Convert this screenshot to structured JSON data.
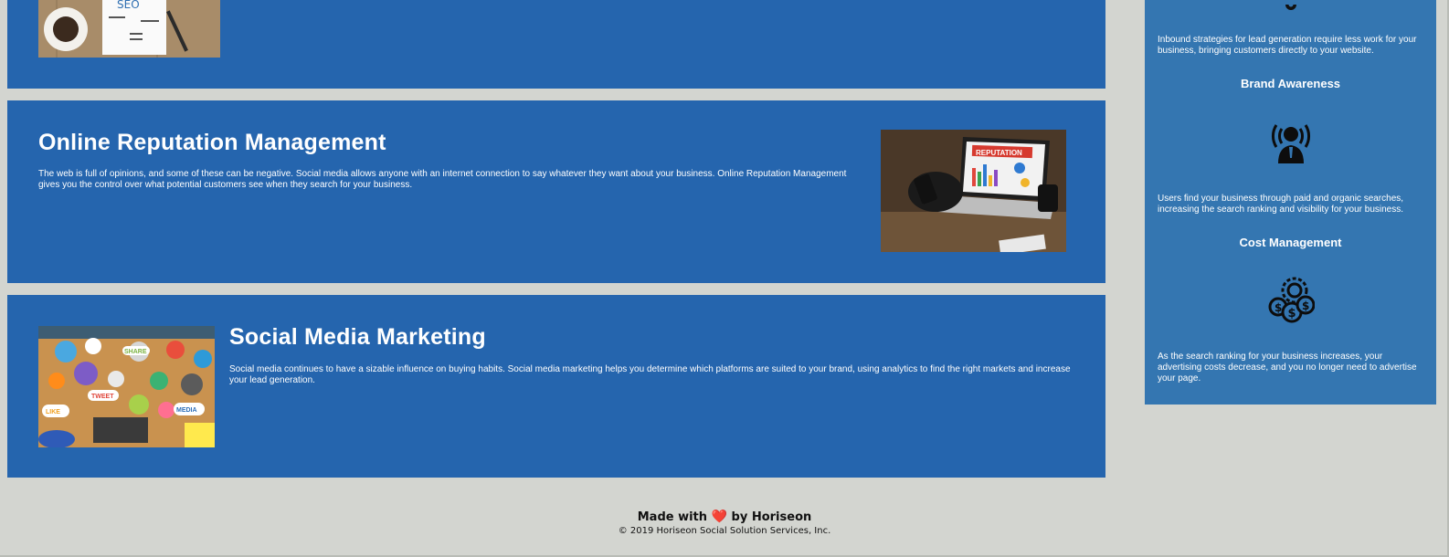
{
  "articles": {
    "seo": {
      "image_alt": "SEO"
    },
    "online_reputation": {
      "title": "Online Reputation Management",
      "text": "The web is full of opinions, and some of these can be negative. Social media allows anyone with an internet connection to say whatever they want about your business. Online Reputation Management gives you the control over what potential customers see when they search for your business.",
      "image_label": "REPUTATION"
    },
    "social_media": {
      "title": "Social Media Marketing",
      "text": "Social media continues to have a sizable influence on buying habits. Social media marketing helps you determine which platforms are suited to your brand, using analytics to find the right markets and increase your lead generation.",
      "image_labels": [
        "SHARE",
        "TWEET",
        "LIKE",
        "MEDIA"
      ]
    }
  },
  "sidebar": {
    "lead_generation_text": "Inbound strategies for lead generation require less work for your business, bringing customers directly to your website.",
    "brand_awareness": {
      "heading": "Brand Awareness",
      "icon": "broadcast-person-icon",
      "text": "Users find your business through paid and organic searches, increasing the search ranking and visibility for your business."
    },
    "cost_management": {
      "heading": "Cost Management",
      "icon": "gear-money-icon",
      "text": "As the search ranking for your business increases, your advertising costs decrease, and you no longer need to advertise your page."
    }
  },
  "footer": {
    "made_prefix": "Made with",
    "heart": "❤️",
    "made_suffix": "by Horiseon",
    "copyright": "© 2019 Horiseon Social Solution Services, Inc."
  },
  "colors": {
    "page_background": "#d3d5d0",
    "article_background": "#2565ae",
    "sidebar_background": "#3476b1",
    "text_on_blue": "#ffffff"
  }
}
